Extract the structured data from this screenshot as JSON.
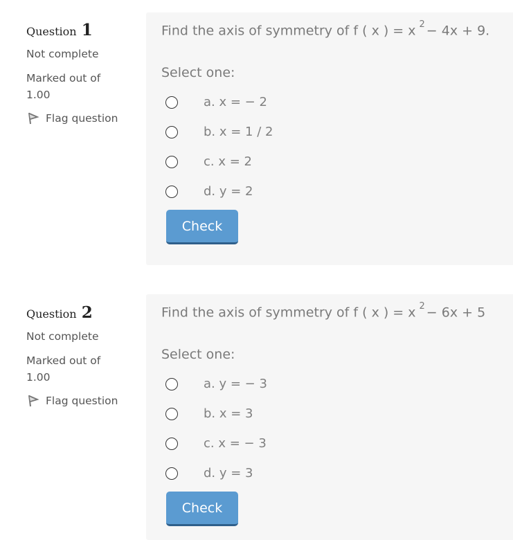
{
  "questions": [
    {
      "label": "Question",
      "number": "1",
      "state": "Not complete",
      "grade_line1": "Marked out of",
      "grade_line2": "1.00",
      "flag_label": "Flag question",
      "text_before": "Find the axis of symmetry of f ( x ) = x",
      "text_sup": "2",
      "text_after": "− 4x + 9.",
      "prompt": "Select one:",
      "answers": [
        {
          "label": "a. x = − 2"
        },
        {
          "label": "b. x = 1 / 2"
        },
        {
          "label": "c. x = 2"
        },
        {
          "label": "d. y = 2"
        }
      ],
      "check_label": "Check"
    },
    {
      "label": "Question",
      "number": "2",
      "state": "Not complete",
      "grade_line1": "Marked out of",
      "grade_line2": "1.00",
      "flag_label": "Flag question",
      "text_before": "Find the axis of symmetry of f ( x ) = x",
      "text_sup": "2",
      "text_after": "− 6x + 5",
      "prompt": "Select one:",
      "answers": [
        {
          "label": "a. y = − 3"
        },
        {
          "label": "b. x = 3"
        },
        {
          "label": "c. x = − 3"
        },
        {
          "label": "d. y = 3"
        }
      ],
      "check_label": "Check"
    }
  ],
  "colors": {
    "panel_bg": "#f6f6f6",
    "button_bg": "#5b9bd1",
    "button_border": "#2f5f8a",
    "question_text": "#7a7a7a"
  }
}
